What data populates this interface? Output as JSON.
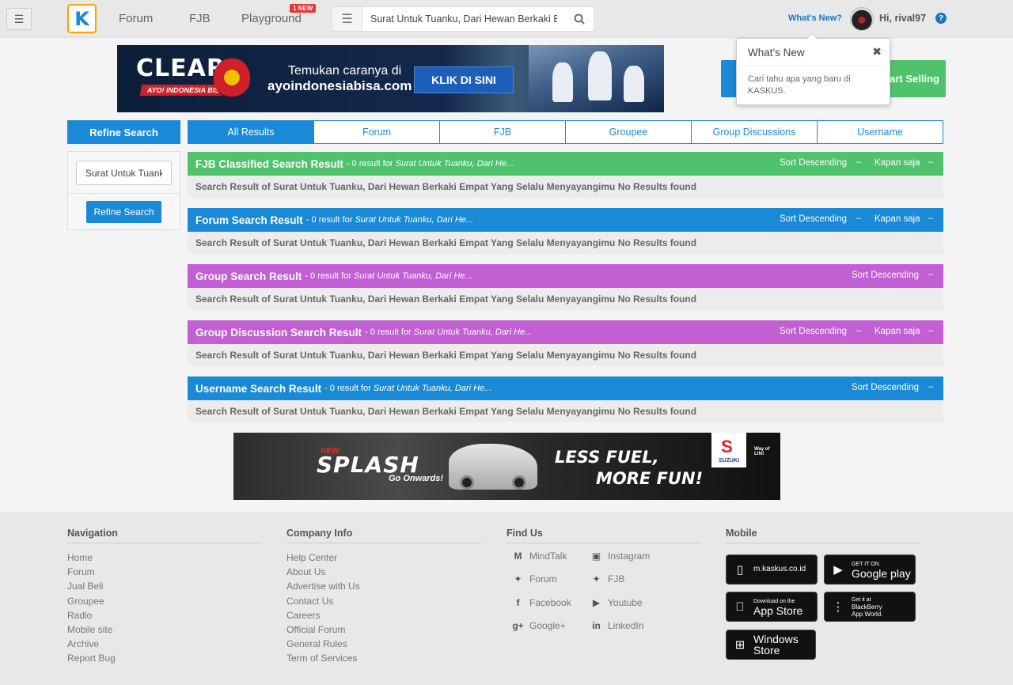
{
  "topbar": {
    "nav": [
      {
        "label": "Forum"
      },
      {
        "label": "FJB"
      },
      {
        "label": "Playground"
      }
    ],
    "new_badge": "1 NEW",
    "search_value": "Surat Untuk Tuanku, Dari Hewan Berkaki Em",
    "whats_new_link": "What's New?",
    "greeting": "Hi, rival97"
  },
  "top_banner": {
    "brand": "CLEAR",
    "brand_tag": "AYO! INDONESIA BISA",
    "line1": "Temukan caranya di",
    "line2": "ayoindonesiabisa.com",
    "cta": "KLIK DI SINI"
  },
  "start_selling": "Start Selling",
  "popover": {
    "title": "What's New",
    "body": "Cari tahu apa yang baru di KASKUS."
  },
  "refine": {
    "header": "Refine Search",
    "input_value": "Surat Untuk Tuanku",
    "button": "Refine Search"
  },
  "tabs": [
    "All Results",
    "Forum",
    "FJB",
    "Groupee",
    "Group Discussions",
    "Username"
  ],
  "results": [
    {
      "title": "FJB Classified Search Result",
      "count": "- 0 result for",
      "query": "Surat Untuk Tuanku, Dari He...",
      "sort": "Sort Descending",
      "time": "Kapan saja",
      "body": "Search Result of Surat Untuk Tuanku, Dari Hewan Berkaki Empat Yang Selalu Menyayangimu No Results found",
      "color": "#4fc36b"
    },
    {
      "title": "Forum Search Result",
      "count": "- 0 result for",
      "query": "Surat Untuk Tuanku, Dari He...",
      "sort": "Sort Descending",
      "time": "Kapan saja",
      "body": "Search Result of Surat Untuk Tuanku, Dari Hewan Berkaki Empat Yang Selalu Menyayangimu No Results found",
      "color": "#1a8ad7"
    },
    {
      "title": "Group Search Result",
      "count": "- 0 result for",
      "query": "Surat Untuk Tuanku, Dari He...",
      "sort": "Sort Descending",
      "time": "",
      "body": "Search Result of Surat Untuk Tuanku, Dari Hewan Berkaki Empat Yang Selalu Menyayangimu No Results found",
      "color": "#c15fd3"
    },
    {
      "title": "Group Discussion Search Result",
      "count": "- 0 result for",
      "query": "Surat Untuk Tuanku, Dari He...",
      "sort": "Sort Descending",
      "time": "Kapan saja",
      "body": "Search Result of Surat Untuk Tuanku, Dari Hewan Berkaki Empat Yang Selalu Menyayangimu No Results found",
      "color": "#c15fd3"
    },
    {
      "title": "Username Search Result",
      "count": "- 0 result for",
      "query": "Surat Untuk Tuanku, Dari He...",
      "sort": "Sort Descending",
      "time": "",
      "body": "Search Result of Surat Untuk Tuanku, Dari Hewan Berkaki Empat Yang Selalu Menyayangimu No Results found",
      "color": "#1a8ad7"
    }
  ],
  "bottom_banner": {
    "new": "NEW",
    "product": "SPLASH",
    "tagline": "Go Onwards!",
    "slogan1": "LESS FUEL,",
    "slogan2": "MORE FUN!",
    "brand": "SUZUKI",
    "brand_tag": "Way of Life!"
  },
  "footer": {
    "navigation": {
      "title": "Navigation",
      "links": [
        "Home",
        "Forum",
        "Jual Beli",
        "Groupee",
        "Radio",
        "Mobile site",
        "Archive",
        "Report Bug"
      ]
    },
    "company": {
      "title": "Company Info",
      "links": [
        "Help Center",
        "About Us",
        "Advertise with Us",
        "Contact Us",
        "Careers",
        "Official Forum",
        "General Rules",
        "Term of Services"
      ]
    },
    "findus": {
      "title": "Find Us",
      "items": [
        "MindTalk",
        "Instagram",
        "Forum",
        "FJB",
        "Facebook",
        "Youtube",
        "Google+",
        "LinkedIn"
      ]
    },
    "mobile": {
      "title": "Mobile",
      "stores": [
        {
          "small": "",
          "big": "m.kaskus.co.id"
        },
        {
          "small": "GET IT ON",
          "big": "Google play"
        },
        {
          "small": "Download on the",
          "big": "App Store"
        },
        {
          "small": "Get it at",
          "big": "BlackBerry App World."
        },
        {
          "small": "",
          "big": "Windows Store"
        }
      ]
    }
  }
}
